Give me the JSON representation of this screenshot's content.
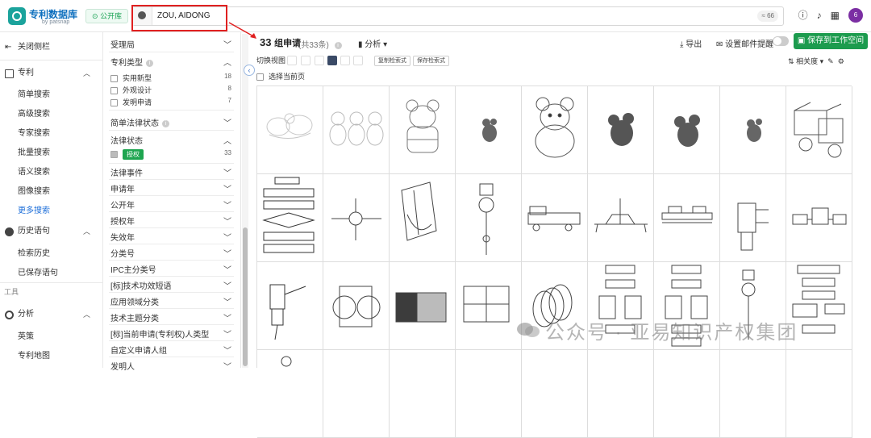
{
  "app": {
    "brand": "专利数据库",
    "brand_sub": "by patsnap",
    "library_button": "公开库"
  },
  "search": {
    "value": "ZOU, AIDONG",
    "approx_count": "≈ 66"
  },
  "top_icons": [
    "help-icon",
    "bell-icon",
    "apps-grid-icon"
  ],
  "avatar_letter": "6",
  "leftnav": {
    "close_sidebar": "关闭侧栏",
    "patent": "专利",
    "patent_items": [
      "简单搜索",
      "高级搜索",
      "专家搜索",
      "批量搜索",
      "语义搜索",
      "图像搜索",
      "更多搜索"
    ],
    "history": "历史语句",
    "history_items": [
      "检索历史",
      "已保存语句"
    ],
    "tools_section": "工具",
    "analysis": "分析",
    "analysis_items": [
      "英策",
      "专利地图"
    ]
  },
  "filter": {
    "sections": [
      {
        "label": "受理局",
        "expanded": false
      },
      {
        "label": "专利类型",
        "expanded": true,
        "info": true,
        "options": [
          {
            "label": "实用新型",
            "count": "18"
          },
          {
            "label": "外观设计",
            "count": "8"
          },
          {
            "label": "发明申请",
            "count": "7"
          }
        ]
      },
      {
        "label": "简单法律状态",
        "expanded": false,
        "info": true
      },
      {
        "label": "法律状态",
        "expanded": true,
        "options": [
          {
            "label": "授权",
            "count": "33",
            "checked": true
          }
        ]
      },
      {
        "label": "法律事件",
        "expanded": false
      },
      {
        "label": "申请年",
        "expanded": false
      },
      {
        "label": "公开年",
        "expanded": false
      },
      {
        "label": "授权年",
        "expanded": false
      },
      {
        "label": "失效年",
        "expanded": false
      },
      {
        "label": "分类号",
        "expanded": false
      },
      {
        "label": "IPC主分类号",
        "expanded": false
      },
      {
        "label": "[标]技术功效短语",
        "expanded": false
      },
      {
        "label": "应用领域分类",
        "expanded": false
      },
      {
        "label": "技术主题分类",
        "expanded": false
      },
      {
        "label": "[标]当前申请(专利权)人类型",
        "expanded": false
      },
      {
        "label": "自定义申请人组",
        "expanded": false
      },
      {
        "label": "发明人",
        "expanded": false
      }
    ]
  },
  "results": {
    "count": "33",
    "count_unit": "组申请",
    "sub": "(共33条)",
    "analysis": "分析",
    "export": "导出",
    "alert": "设置邮件提醒",
    "save": "保存到工作空间",
    "switch_view": "切换视图",
    "copy_query": "复制检索式",
    "save_query": "保存检索式",
    "sort": "相关度",
    "select_page": "选择当前页"
  },
  "watermark": "公众号 · 亚易知识产权集团",
  "colors": {
    "brand": "#0d6fbe",
    "accent_green": "#1c9b4e",
    "link_blue": "#1e6fd9",
    "highlight_red": "#e02020"
  }
}
